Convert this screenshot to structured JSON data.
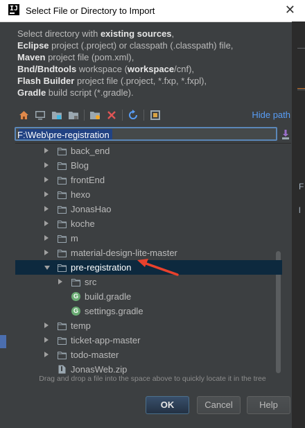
{
  "window": {
    "title": "Select File or Directory to Import",
    "app_icon": "IJ",
    "close": "✕"
  },
  "description": {
    "line1": [
      {
        "t": "Select directory with ",
        "b": false
      },
      {
        "t": "existing sources",
        "b": true
      },
      {
        "t": ",",
        "b": false
      }
    ],
    "line2": [
      {
        "t": "Eclipse",
        "b": true
      },
      {
        "t": " project (.project) or classpath (.classpath) file,",
        "b": false
      }
    ],
    "line3": [
      {
        "t": "Maven",
        "b": true
      },
      {
        "t": " project file (pom.xml),",
        "b": false
      }
    ],
    "line4": [
      {
        "t": "Bnd/Bndtools",
        "b": true
      },
      {
        "t": " workspace (",
        "b": false
      },
      {
        "t": "workspace",
        "b": true
      },
      {
        "t": "/cnf),",
        "b": false
      }
    ],
    "line5": [
      {
        "t": "Flash Builder",
        "b": true
      },
      {
        "t": " project file (.project, *.fxp, *.fxpl),",
        "b": false
      }
    ],
    "line6": [
      {
        "t": "Gradle",
        "b": true
      },
      {
        "t": " build script (*.gradle).",
        "b": false
      }
    ]
  },
  "toolbar": {
    "icons": [
      "home-icon",
      "desktop-icon",
      "project-folder-icon",
      "module-folder-icon",
      "new-folder-icon",
      "delete-icon",
      "refresh-icon",
      "show-hidden-icon"
    ],
    "hide_path": "Hide path"
  },
  "path_field": {
    "value": "F:\\Web\\pre-registration"
  },
  "tree": {
    "rows": [
      {
        "label": "back_end",
        "kind": "folder",
        "depth": 0,
        "expanded": false
      },
      {
        "label": "Blog",
        "kind": "folder",
        "depth": 0,
        "expanded": false
      },
      {
        "label": "frontEnd",
        "kind": "folder",
        "depth": 0,
        "expanded": false
      },
      {
        "label": "hexo",
        "kind": "folder",
        "depth": 0,
        "expanded": false
      },
      {
        "label": "JonasHao",
        "kind": "folder",
        "depth": 0,
        "expanded": false
      },
      {
        "label": "koche",
        "kind": "folder",
        "depth": 0,
        "expanded": false
      },
      {
        "label": "m",
        "kind": "folder",
        "depth": 0,
        "expanded": false
      },
      {
        "label": "material-design-lite-master",
        "kind": "folder",
        "depth": 0,
        "expanded": false
      },
      {
        "label": "pre-registration",
        "kind": "folder",
        "depth": 0,
        "expanded": true,
        "selected": true
      },
      {
        "label": "src",
        "kind": "folder",
        "depth": 1,
        "expanded": false
      },
      {
        "label": "build.gradle",
        "kind": "gradle",
        "depth": 1
      },
      {
        "label": "settings.gradle",
        "kind": "gradle",
        "depth": 1
      },
      {
        "label": "temp",
        "kind": "folder",
        "depth": 0,
        "expanded": false
      },
      {
        "label": "ticket-app-master",
        "kind": "folder",
        "depth": 0,
        "expanded": false
      },
      {
        "label": "todo-master",
        "kind": "folder",
        "depth": 0,
        "expanded": false
      },
      {
        "label": "JonasWeb.zip",
        "kind": "zip",
        "depth": 0
      }
    ]
  },
  "hint": "Drag and drop a file into the space above to quickly locate it in the tree",
  "buttons": {
    "ok": "OK",
    "cancel": "Cancel",
    "help": "Help"
  },
  "colors": {
    "background": "#3c3f41",
    "link": "#589df6",
    "selection": "#0d293e",
    "accent_arrow": "#e8412c"
  },
  "ide_background": {
    "letters": [
      "F",
      "l"
    ]
  }
}
